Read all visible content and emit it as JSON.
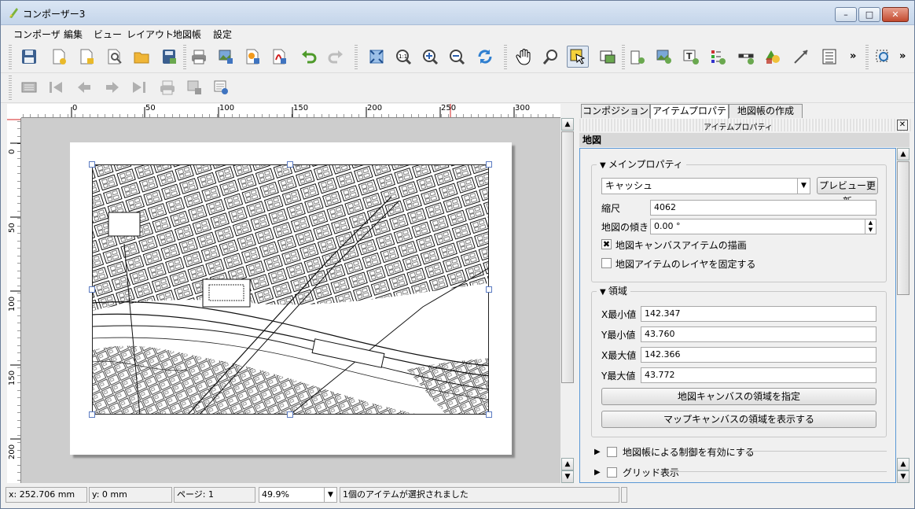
{
  "window": {
    "title": "コンポーザー3",
    "minimize": "–",
    "maximize": "□",
    "close": "✕"
  },
  "menubar": [
    "コンポーザ",
    "編集",
    "ビュー",
    "レイアウト",
    "地図帳",
    "設定"
  ],
  "toolbar1": {
    "icons": [
      "save-icon",
      "new-composer-icon",
      "duplicate-composer-icon",
      "composer-manager-icon",
      "open-template-icon",
      "save-template-icon",
      "print-icon",
      "export-image-icon",
      "export-svg-icon",
      "export-pdf-icon",
      "undo-icon",
      "redo-icon",
      "zoom-full-icon",
      "zoom-actual-icon",
      "zoom-in-icon",
      "zoom-out-icon",
      "refresh-icon",
      "pan-icon",
      "zoom-tool-icon",
      "select-move-icon",
      "move-content-icon",
      "add-map-icon",
      "add-image-icon",
      "add-label-icon",
      "add-legend-icon",
      "add-scalebar-icon",
      "add-shape-icon",
      "add-arrow-icon",
      "add-table-icon",
      "select-icon"
    ],
    "more": "»"
  },
  "toolbar2": {
    "icons": [
      "atlas-preview-icon",
      "first-feature-icon",
      "prev-feature-icon",
      "next-feature-icon",
      "last-feature-icon",
      "print-atlas-icon",
      "export-atlas-icon",
      "atlas-settings-icon"
    ]
  },
  "rulers": {
    "top": [
      "0",
      "50",
      "100",
      "150",
      "200",
      "250",
      "300"
    ],
    "left": [
      "0",
      "50",
      "100",
      "150",
      "200"
    ]
  },
  "tabs": [
    "コンポジション",
    "アイテムプロパティ",
    "地図帳の作成"
  ],
  "dock": {
    "title": "アイテムプロパティ",
    "close": "✕"
  },
  "section": "地図",
  "main_props": {
    "title": "メインプロパティ",
    "cache": "キャッシュ",
    "preview_button": "プレビュー更新",
    "scale_label": "縮尺",
    "scale": "4062",
    "rotation_label": "地図の傾き",
    "rotation": "0.00 °",
    "draw_items_label": "地図キャンバスアイテムの描画",
    "draw_items_check": "✖",
    "lock_layers_label": "地図アイテムのレイヤを固定する"
  },
  "extent": {
    "title": "領域",
    "xmin_label": "X最小値",
    "xmin": "142.347",
    "ymin_label": "Y最小値",
    "ymin": "43.760",
    "xmax_label": "X最大値",
    "xmax": "142.366",
    "ymax_label": "Y最大値",
    "ymax": "43.772",
    "set_canvas_button": "地図キャンバスの領域を指定",
    "view_canvas_button": "マップキャンバスの領域を表示する"
  },
  "atlas_control": "地図帳による制御を有効にする",
  "grid": "グリッド表示",
  "status": {
    "x": "x: 252.706 mm",
    "y": "y: 0 mm",
    "page": "ページ: 1",
    "zoom": "49.9%",
    "message": "1個のアイテムが選択されました"
  }
}
